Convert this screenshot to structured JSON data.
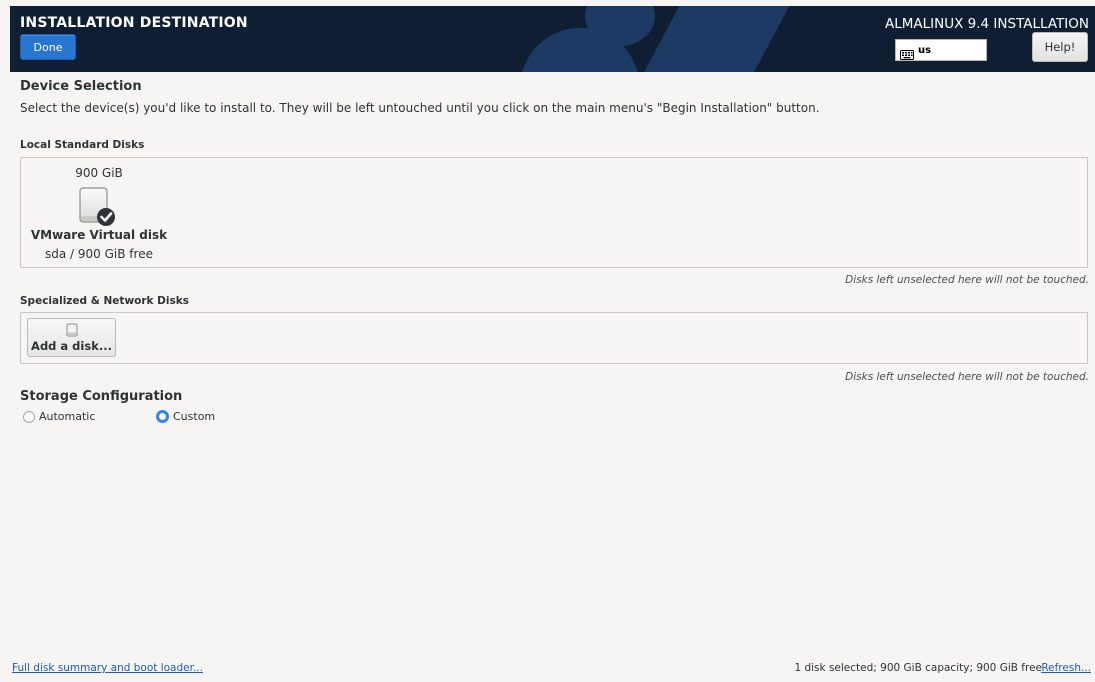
{
  "header": {
    "spoke_title": "INSTALLATION DESTINATION",
    "done_label": "Done",
    "product_title": "ALMALINUX 9.4 INSTALLATION",
    "keyboard_layout": "us",
    "keyboard_icon": "keyboard-icon",
    "help_label": "Help!",
    "colors": {
      "bar": "#0f1e33",
      "accent": "#2876d0"
    }
  },
  "device_selection": {
    "title": "Device Selection",
    "description": "Select the device(s) you'd like to install to.  They will be left untouched until you click on the main menu's \"Begin Installation\" button."
  },
  "local_disks": {
    "title": "Local Standard Disks",
    "disks": [
      {
        "size": "900 GiB",
        "name": "VMware Virtual disk",
        "detail": "sda  /  900 GiB free",
        "selected": true,
        "icon": "hard-disk-checked-icon"
      }
    ],
    "note": "Disks left unselected here will not be touched."
  },
  "network_disks": {
    "title": "Specialized & Network Disks",
    "add_label": "Add a disk...",
    "add_icon": "disk-small-icon",
    "note": "Disks left unselected here will not be touched."
  },
  "storage_config": {
    "title": "Storage Configuration",
    "automatic_label": "Automatic",
    "custom_label": "Custom",
    "selected": "Custom"
  },
  "footer": {
    "summary_link": "Full disk summary and boot loader...",
    "status": "1 disk selected; 900 GiB capacity; 900 GiB free",
    "refresh_link": "Refresh..."
  }
}
